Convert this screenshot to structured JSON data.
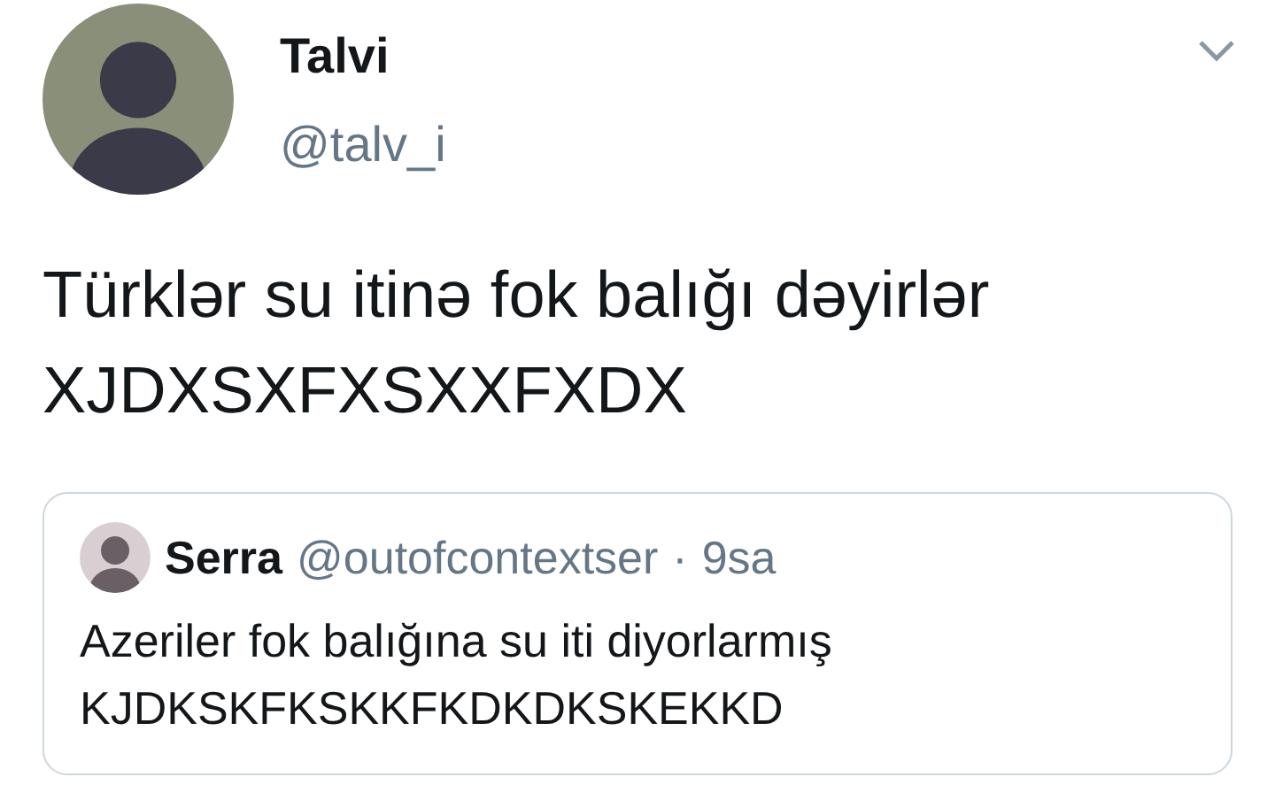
{
  "tweet": {
    "author": {
      "name": "Talvi",
      "handle": "@talv_i"
    },
    "text_lines": [
      "Türklər su itinə fok balığı dəyirlər",
      "XJDXSXFXSXXFXDX"
    ],
    "quoted": {
      "author": {
        "name": "Serra",
        "handle": "@outofcontextser",
        "separator": "·",
        "time": "9sa"
      },
      "text_lines": [
        "Azeriler fok balığına su iti diyorlarmış",
        "KJDKSKFKSKKFKDKDKSKEKKD"
      ]
    }
  }
}
